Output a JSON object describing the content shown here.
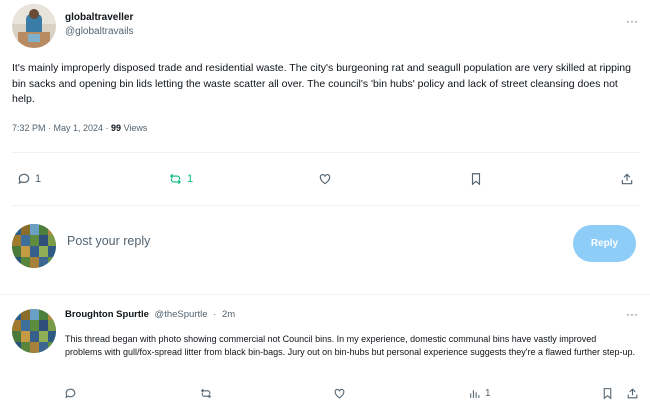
{
  "post": {
    "display_name": "globaltraveller",
    "handle": "@globaltravails",
    "more_label": "···",
    "text": "It's mainly improperly disposed trade and residential waste. The city's burgeoning rat and seagull population are very skilled at ripping bin sacks and opening bin lids letting the waste scatter all over. The council's 'bin hubs' policy and lack of street cleansing does not help.",
    "timestamp": "7:32 PM · May 1, 2024 · ",
    "views_count": "99",
    "views_label": " Views",
    "actions": {
      "reply_count": "1",
      "repost_count": "1"
    }
  },
  "composer": {
    "placeholder": "Post your reply",
    "reply_button": "Reply"
  },
  "reply": {
    "display_name": "Broughton Spurtle",
    "handle": "@theSpurtle",
    "separator": "·",
    "time": "2m",
    "more_label": "···",
    "text": "This thread began with photo showing commercial not Council bins. In my experience, domestic communal bins have vastly improved problems with gull/fox-spread litter from black bin-bags. Jury out on bin-hubs but personal experience suggests they're a flawed further step-up.",
    "actions": {
      "views_count": "1"
    }
  },
  "colors": {
    "accent": "#1d9bf0",
    "reply_button_bg": "#8ecdf8",
    "repost_green": "#00ba7c",
    "muted": "#536471"
  }
}
